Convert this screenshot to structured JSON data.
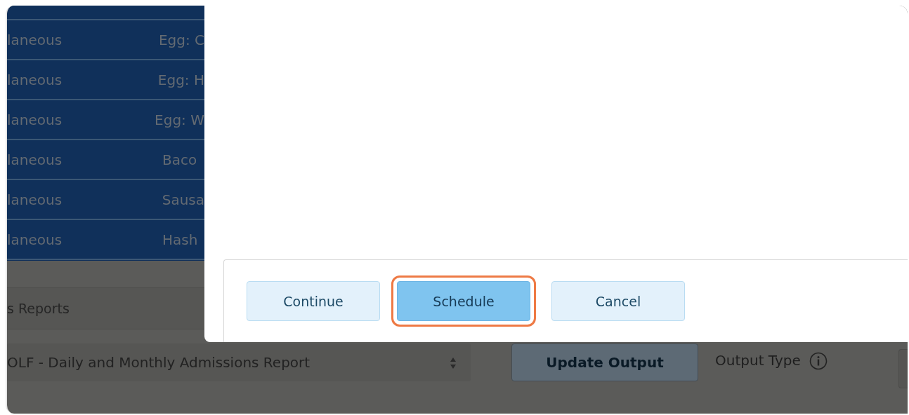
{
  "table": {
    "rows": [
      {
        "column_1": "laneous",
        "column_2": "Egg: C"
      },
      {
        "column_1": "laneous",
        "column_2": "Egg: H"
      },
      {
        "column_1": "laneous",
        "column_2": "Egg: W"
      },
      {
        "column_1": "laneous",
        "column_2": "Baco"
      },
      {
        "column_1": "laneous",
        "column_2": "Sausa"
      },
      {
        "column_1": "laneous",
        "column_2": "Hash"
      }
    ]
  },
  "reports_field": {
    "value": "s Reports"
  },
  "report_select": {
    "value": "OLF - Daily and Monthly Admissions Report"
  },
  "update_button": {
    "label": "Update Output"
  },
  "output_type": {
    "label": "Output Type"
  },
  "dialog": {
    "buttons": [
      {
        "label": "Continue",
        "primary": false,
        "highlighted": false
      },
      {
        "label": "Schedule",
        "primary": true,
        "highlighted": true
      },
      {
        "label": "Cancel",
        "primary": false,
        "highlighted": false
      }
    ]
  }
}
